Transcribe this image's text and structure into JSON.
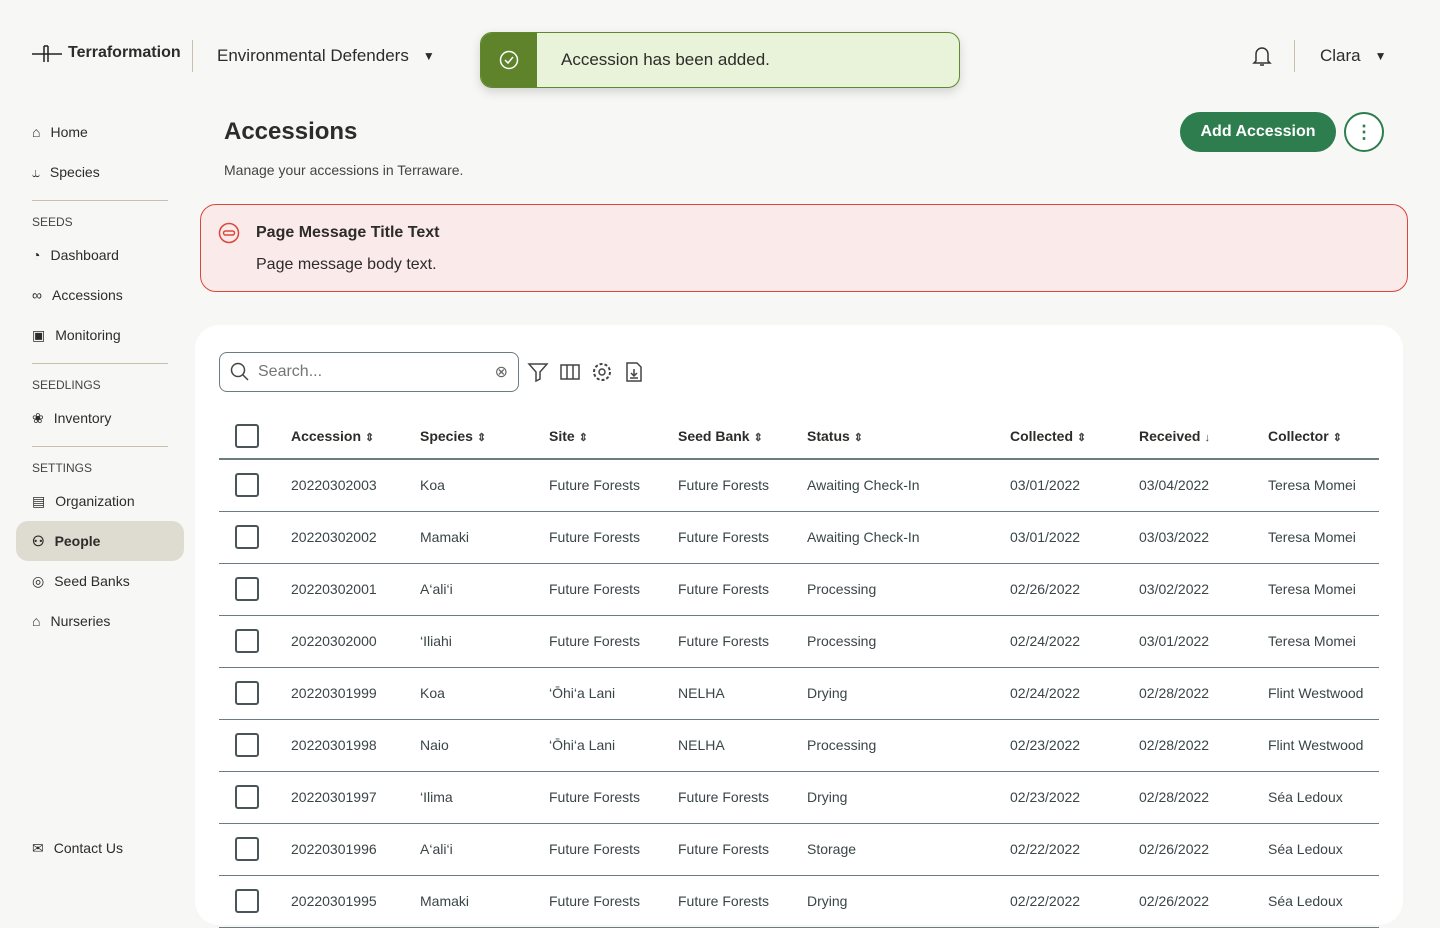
{
  "header": {
    "brand": "Terraformation",
    "org": "Environmental Defenders",
    "user": "Clara"
  },
  "toast": {
    "message": "Accession has been added.",
    "color": "#5e832b"
  },
  "sidebar": {
    "top": [
      {
        "label": "Home",
        "icon": "home-icon"
      },
      {
        "label": "Species",
        "icon": "species-icon"
      }
    ],
    "seeds_header": "SEEDS",
    "seeds": [
      {
        "label": "Dashboard",
        "icon": "dashboard-icon"
      },
      {
        "label": "Accessions",
        "icon": "accessions-icon"
      },
      {
        "label": "Monitoring",
        "icon": "monitoring-icon"
      }
    ],
    "seedlings_header": "SEEDLINGS",
    "seedlings": [
      {
        "label": "Inventory",
        "icon": "inventory-icon"
      }
    ],
    "settings_header": "SETTINGS",
    "settings": [
      {
        "label": "Organization",
        "icon": "organization-icon"
      },
      {
        "label": "People",
        "icon": "people-icon",
        "active": true
      },
      {
        "label": "Seed Banks",
        "icon": "seed-banks-icon"
      },
      {
        "label": "Nurseries",
        "icon": "nurseries-icon"
      }
    ],
    "contact": "Contact Us"
  },
  "page": {
    "title": "Accessions",
    "subtitle": "Manage your accessions in Terraware.",
    "add_button": "Add Accession",
    "accent": "#2e7d4f"
  },
  "page_message": {
    "title": "Page Message Title Text",
    "body": "Page message body text.",
    "color": "#d9473b"
  },
  "search": {
    "placeholder": "Search...",
    "value": ""
  },
  "table": {
    "columns": [
      {
        "label": "Accession",
        "sort": "both"
      },
      {
        "label": "Species",
        "sort": "both"
      },
      {
        "label": "Site",
        "sort": "both"
      },
      {
        "label": "Seed Bank",
        "sort": "both"
      },
      {
        "label": "Status",
        "sort": "both"
      },
      {
        "label": "Collected",
        "sort": "both"
      },
      {
        "label": "Received",
        "sort": "desc"
      },
      {
        "label": "Collector",
        "sort": "both"
      }
    ],
    "rows": [
      [
        "20220302003",
        "Koa",
        "Future Forests",
        "Future Forests",
        "Awaiting Check-In",
        "03/01/2022",
        "03/04/2022",
        "Teresa Momei"
      ],
      [
        "20220302002",
        "Mamaki",
        "Future Forests",
        "Future Forests",
        "Awaiting Check-In",
        "03/01/2022",
        "03/03/2022",
        "Teresa Momei"
      ],
      [
        "20220302001",
        "A‘ali‘i",
        "Future Forests",
        "Future Forests",
        "Processing",
        "02/26/2022",
        "03/02/2022",
        "Teresa Momei"
      ],
      [
        "20220302000",
        "‘Iliahi",
        "Future Forests",
        "Future Forests",
        "Processing",
        "02/24/2022",
        "03/01/2022",
        "Teresa Momei"
      ],
      [
        "20220301999",
        "Koa",
        "‘Ōhi‘a Lani",
        "NELHA",
        "Drying",
        "02/24/2022",
        "02/28/2022",
        "Flint Westwood"
      ],
      [
        "20220301998",
        "Naio",
        "‘Ōhi‘a Lani",
        "NELHA",
        "Processing",
        "02/23/2022",
        "02/28/2022",
        "Flint Westwood"
      ],
      [
        "20220301997",
        "‘Ilima",
        "Future Forests",
        "Future Forests",
        "Drying",
        "02/23/2022",
        "02/28/2022",
        "Séa Ledoux"
      ],
      [
        "20220301996",
        "A‘ali‘i",
        "Future Forests",
        "Future Forests",
        "Storage",
        "02/22/2022",
        "02/26/2022",
        "Séa Ledoux"
      ],
      [
        "20220301995",
        "Mamaki",
        "Future Forests",
        "Future Forests",
        "Drying",
        "02/22/2022",
        "02/26/2022",
        "Séa Ledoux"
      ]
    ]
  }
}
